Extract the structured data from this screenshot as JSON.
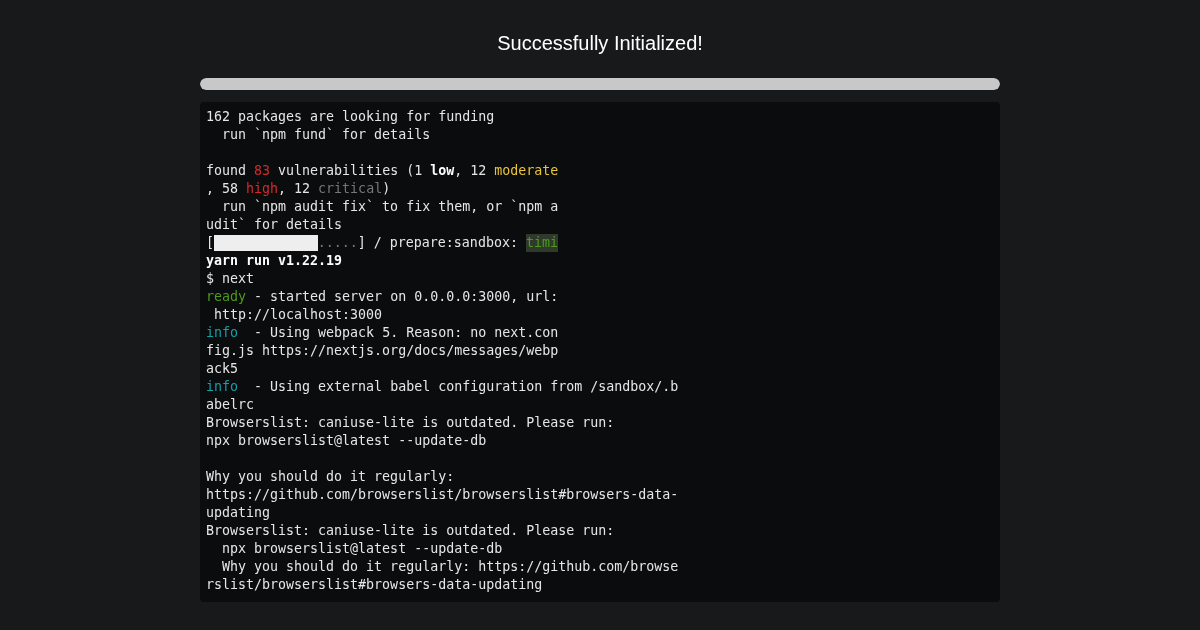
{
  "title": "Successfully Initialized!",
  "progress": {
    "level": 1
  },
  "terminal": {
    "lines": [
      {
        "kind": "text",
        "segments": [
          {
            "kind": "plain",
            "text": "162 packages are looking for funding"
          }
        ]
      },
      {
        "kind": "text",
        "segments": [
          {
            "kind": "plain",
            "text": "  run `npm fund` for details"
          }
        ]
      },
      {
        "kind": "blank"
      },
      {
        "kind": "text",
        "segments": [
          {
            "kind": "plain",
            "text": "found "
          },
          {
            "kind": "red",
            "text": "83"
          },
          {
            "kind": "plain",
            "text": " vulnerabilities (1 "
          },
          {
            "kind": "bold",
            "text": "low"
          },
          {
            "kind": "plain",
            "text": ", 12 "
          },
          {
            "kind": "yellow",
            "text": "moderate"
          }
        ]
      },
      {
        "kind": "text",
        "segments": [
          {
            "kind": "plain",
            "text": ", 58 "
          },
          {
            "kind": "red",
            "text": "high"
          },
          {
            "kind": "plain",
            "text": ", 12 "
          },
          {
            "kind": "grey",
            "text": "critical"
          },
          {
            "kind": "plain",
            "text": ")"
          }
        ]
      },
      {
        "kind": "text",
        "segments": [
          {
            "kind": "plain",
            "text": "  run `npm audit fix` to fix them, or `npm a"
          }
        ]
      },
      {
        "kind": "text",
        "segments": [
          {
            "kind": "plain",
            "text": "udit` for details"
          }
        ]
      },
      {
        "kind": "text",
        "segments": [
          {
            "kind": "plain",
            "text": "["
          },
          {
            "kind": "gauge",
            "level": 0.72,
            "rest": "....."
          },
          {
            "kind": "plain",
            "text": "] / prepare:sandbox: "
          },
          {
            "kind": "highlight",
            "text": "timi"
          }
        ]
      },
      {
        "kind": "text",
        "segments": [
          {
            "kind": "bold",
            "text": "yarn run v1.22.19"
          }
        ]
      },
      {
        "kind": "text",
        "segments": [
          {
            "kind": "plain",
            "text": "$ next"
          }
        ]
      },
      {
        "kind": "text",
        "segments": [
          {
            "kind": "green",
            "text": "ready"
          },
          {
            "kind": "plain",
            "text": " - started server on 0.0.0.0:3000, url:"
          }
        ]
      },
      {
        "kind": "text",
        "segments": [
          {
            "kind": "plain",
            "text": " http://localhost:3000"
          }
        ]
      },
      {
        "kind": "text",
        "segments": [
          {
            "kind": "teal",
            "text": "info"
          },
          {
            "kind": "plain",
            "text": "  - Using webpack 5. Reason: no next.con"
          }
        ]
      },
      {
        "kind": "text",
        "segments": [
          {
            "kind": "plain",
            "text": "fig.js https://nextjs.org/docs/messages/webp"
          }
        ]
      },
      {
        "kind": "text",
        "segments": [
          {
            "kind": "plain",
            "text": "ack5"
          }
        ]
      },
      {
        "kind": "text",
        "segments": [
          {
            "kind": "teal",
            "text": "info"
          },
          {
            "kind": "plain",
            "text": "  - Using external babel configuration from /sandbox/.b"
          }
        ]
      },
      {
        "kind": "text",
        "segments": [
          {
            "kind": "plain",
            "text": "abelrc"
          }
        ]
      },
      {
        "kind": "text",
        "segments": [
          {
            "kind": "plain",
            "text": "Browserslist: caniuse-lite is outdated. Please run:"
          }
        ]
      },
      {
        "kind": "text",
        "segments": [
          {
            "kind": "plain",
            "text": "npx browserslist@latest --update-db"
          }
        ]
      },
      {
        "kind": "blank"
      },
      {
        "kind": "text",
        "segments": [
          {
            "kind": "plain",
            "text": "Why you should do it regularly:"
          }
        ]
      },
      {
        "kind": "text",
        "segments": [
          {
            "kind": "plain",
            "text": "https://github.com/browserslist/browserslist#browsers-data-"
          }
        ]
      },
      {
        "kind": "text",
        "segments": [
          {
            "kind": "plain",
            "text": "updating"
          }
        ]
      },
      {
        "kind": "text",
        "segments": [
          {
            "kind": "plain",
            "text": "Browserslist: caniuse-lite is outdated. Please run:"
          }
        ]
      },
      {
        "kind": "text",
        "segments": [
          {
            "kind": "plain",
            "text": "  npx browserslist@latest --update-db"
          }
        ]
      },
      {
        "kind": "text",
        "segments": [
          {
            "kind": "plain",
            "text": "  Why you should do it regularly: https://github.com/browse"
          }
        ]
      },
      {
        "kind": "text",
        "segments": [
          {
            "kind": "plain",
            "text": "rslist/browserslist#browsers-data-updating"
          }
        ]
      }
    ]
  }
}
